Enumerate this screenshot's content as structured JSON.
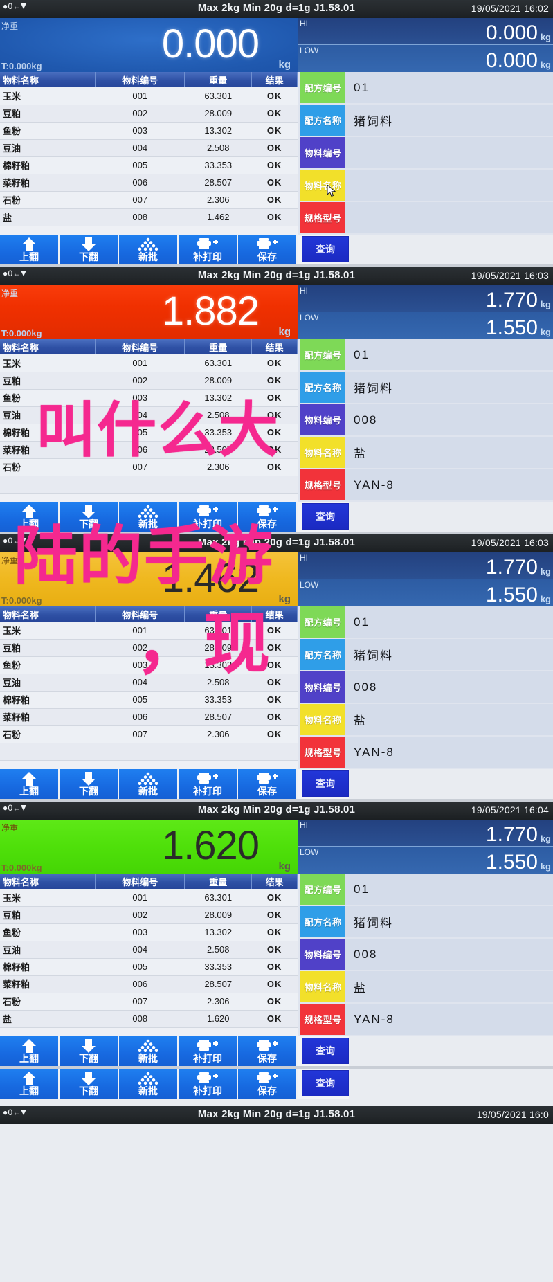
{
  "device": {
    "status_spec": "Max 2kg  Min 20g  d=1g    J1.58.01",
    "version": "J1.58.01",
    "zero_icon": "zero-indicator-icon",
    "stable_icon": "stability-indicator-icon",
    "net_label": "净重",
    "unit": "kg",
    "hi_label": "HI",
    "low_label": "LOW"
  },
  "table": {
    "headers": [
      "物料名称",
      "物料编号",
      "重量",
      "结果"
    ]
  },
  "field_labels": {
    "formula_no": "配方编号",
    "formula_name": "配方名称",
    "material_no": "物料编号",
    "material_name": "物料名称",
    "spec_model": "规格型号"
  },
  "field_colors": {
    "formula_no": "#7ed957",
    "formula_name": "#2f9ee8",
    "material_no": "#5041c8",
    "material_name": "#f2e02a",
    "spec_model": "#f2333a"
  },
  "toolbar": {
    "page_up": "上翻",
    "page_down": "下翻",
    "new_batch": "新批",
    "reprint": "补打印",
    "save": "保存",
    "query": "查询",
    "icons": [
      "arrow-up-icon",
      "arrow-down-icon",
      "stack-icon",
      "printer-plus-icon",
      "printer-plus-icon"
    ]
  },
  "watermark": {
    "line1": "叫什么大",
    "line2": "陆的手游",
    "line3": "，现"
  },
  "panels": [
    {
      "date": "19/05/2021",
      "time": "16:02",
      "display_color": "blue",
      "weight": "0.000",
      "tare": "T:0.000kg",
      "hi": "0.000",
      "low": "0.000",
      "fields": {
        "formula_no": "01",
        "formula_name": "猪饲料",
        "material_no": "",
        "material_name": "",
        "spec_model": ""
      },
      "rows": [
        {
          "name": "玉米",
          "no": "001",
          "weight": "63.301",
          "result": "OK"
        },
        {
          "name": "豆粕",
          "no": "002",
          "weight": "28.009",
          "result": "OK"
        },
        {
          "name": "鱼粉",
          "no": "003",
          "weight": "13.302",
          "result": "OK"
        },
        {
          "name": "豆油",
          "no": "004",
          "weight": "2.508",
          "result": "OK"
        },
        {
          "name": "棉籽粕",
          "no": "005",
          "weight": "33.353",
          "result": "OK"
        },
        {
          "name": "菜籽粕",
          "no": "006",
          "weight": "28.507",
          "result": "OK"
        },
        {
          "name": "石粉",
          "no": "007",
          "weight": "2.306",
          "result": "OK"
        },
        {
          "name": "盐",
          "no": "008",
          "weight": "1.462",
          "result": "OK"
        }
      ]
    },
    {
      "date": "19/05/2021",
      "time": "16:03",
      "display_color": "red",
      "weight": "1.882",
      "tare": "T:0.000kg",
      "hi": "1.770",
      "low": "1.550",
      "fields": {
        "formula_no": "01",
        "formula_name": "猪饲料",
        "material_no": "008",
        "material_name": "盐",
        "spec_model": "YAN-8"
      },
      "rows": [
        {
          "name": "玉米",
          "no": "001",
          "weight": "63.301",
          "result": "OK"
        },
        {
          "name": "豆粕",
          "no": "002",
          "weight": "28.009",
          "result": "OK"
        },
        {
          "name": "鱼粉",
          "no": "003",
          "weight": "13.302",
          "result": "OK"
        },
        {
          "name": "豆油",
          "no": "004",
          "weight": "2.508",
          "result": "OK"
        },
        {
          "name": "棉籽粕",
          "no": "005",
          "weight": "33.353",
          "result": "OK"
        },
        {
          "name": "菜籽粕",
          "no": "006",
          "weight": "28.507",
          "result": "OK"
        },
        {
          "name": "石粉",
          "no": "007",
          "weight": "2.306",
          "result": "OK"
        },
        {
          "name": "",
          "no": "",
          "weight": "",
          "result": ""
        }
      ]
    },
    {
      "date": "19/05/2021",
      "time": "16:03",
      "display_color": "amber",
      "weight": "1.462",
      "tare": "T:0.000kg",
      "hi": "1.770",
      "low": "1.550",
      "fields": {
        "formula_no": "01",
        "formula_name": "猪饲料",
        "material_no": "008",
        "material_name": "盐",
        "spec_model": "YAN-8"
      },
      "rows": [
        {
          "name": "玉米",
          "no": "001",
          "weight": "63.301",
          "result": "OK"
        },
        {
          "name": "豆粕",
          "no": "002",
          "weight": "28.009",
          "result": "OK"
        },
        {
          "name": "鱼粉",
          "no": "003",
          "weight": "13.302",
          "result": "OK"
        },
        {
          "name": "豆油",
          "no": "004",
          "weight": "2.508",
          "result": "OK"
        },
        {
          "name": "棉籽粕",
          "no": "005",
          "weight": "33.353",
          "result": "OK"
        },
        {
          "name": "菜籽粕",
          "no": "006",
          "weight": "28.507",
          "result": "OK"
        },
        {
          "name": "石粉",
          "no": "007",
          "weight": "2.306",
          "result": "OK"
        },
        {
          "name": "",
          "no": "",
          "weight": "",
          "result": ""
        }
      ]
    },
    {
      "date": "19/05/2021",
      "time": "16:04",
      "display_color": "green",
      "weight": "1.620",
      "tare": "T:0.000kg",
      "hi": "1.770",
      "low": "1.550",
      "fields": {
        "formula_no": "01",
        "formula_name": "猪饲料",
        "material_no": "008",
        "material_name": "盐",
        "spec_model": "YAN-8"
      },
      "rows": [
        {
          "name": "玉米",
          "no": "001",
          "weight": "63.301",
          "result": "OK"
        },
        {
          "name": "豆粕",
          "no": "002",
          "weight": "28.009",
          "result": "OK"
        },
        {
          "name": "鱼粉",
          "no": "003",
          "weight": "13.302",
          "result": "OK"
        },
        {
          "name": "豆油",
          "no": "004",
          "weight": "2.508",
          "result": "OK"
        },
        {
          "name": "棉籽粕",
          "no": "005",
          "weight": "33.353",
          "result": "OK"
        },
        {
          "name": "菜籽粕",
          "no": "006",
          "weight": "28.507",
          "result": "OK"
        },
        {
          "name": "石粉",
          "no": "007",
          "weight": "2.306",
          "result": "OK"
        },
        {
          "name": "盐",
          "no": "008",
          "weight": "1.620",
          "result": "OK"
        }
      ]
    }
  ],
  "bottom_strip": {
    "date": "19/05/2021",
    "time": "16:0",
    "spec": "Max 2kg  Min 20g  d=1g    J1.58.01"
  }
}
